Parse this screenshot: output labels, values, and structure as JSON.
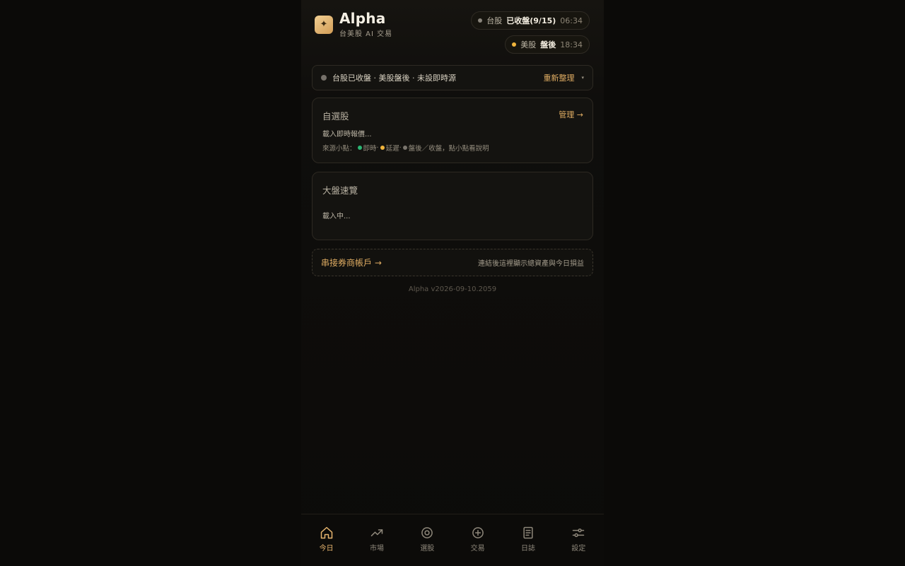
{
  "header": {
    "logo_glyph": "✦",
    "title": "Alpha",
    "subtitle": "台美股 AI 交易"
  },
  "markets": [
    {
      "market": "台股",
      "status": "已收盤(9/15)",
      "time": "06:34",
      "dot_color": "#8a857c"
    },
    {
      "market": "美股",
      "status": "盤後",
      "time": "18:34",
      "dot_color": "#f0b43c"
    }
  ],
  "status_bar": {
    "text": "台股已收盤 · 美股盤後 · 未設即時源",
    "refresh_label": "重新整理",
    "caret": "▾"
  },
  "watchlist": {
    "title": "自選股",
    "manage_label": "管理 →",
    "loading": "載入即時報價...",
    "legend": {
      "prefix": "來源小點：",
      "realtime": "即時",
      "sep1": " · ",
      "delayed": "延遲",
      "sep2": " · ",
      "closed": "盤後／收盤，點小點看說明",
      "realtime_color": "#2bb673",
      "delayed_color": "#f0b43c",
      "closed_color": "#7a756d"
    }
  },
  "market_overview": {
    "title": "大盤速覽",
    "loading": "載入中..."
  },
  "broker": {
    "link_label": "串接券商帳戶 →",
    "hint": "連結後這裡顯示總資產與今日損益"
  },
  "version": "Alpha v2026-09-10.2059",
  "tabs": [
    {
      "label": "今日",
      "icon": "home-icon",
      "active": true
    },
    {
      "label": "市場",
      "icon": "trending-up-icon",
      "active": false
    },
    {
      "label": "選股",
      "icon": "target-icon",
      "active": false
    },
    {
      "label": "交易",
      "icon": "plus-circle-icon",
      "active": false
    },
    {
      "label": "日誌",
      "icon": "journal-icon",
      "active": false
    },
    {
      "label": "設定",
      "icon": "sliders-icon",
      "active": false
    }
  ],
  "colors": {
    "accent": "#e0ad63",
    "background": "#0b0a08",
    "card": "#141310"
  }
}
